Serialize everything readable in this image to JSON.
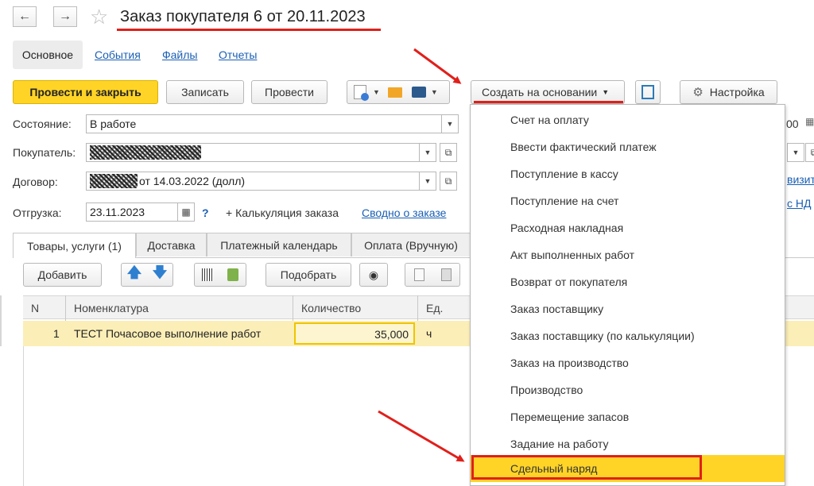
{
  "title": "Заказ покупателя 6 от 20.11.2023",
  "nav": {
    "back": "←",
    "forward": "→",
    "star": "☆"
  },
  "tabs_top": [
    "Основное",
    "События",
    "Файлы",
    "Отчеты"
  ],
  "toolbar": {
    "post_close": "Провести и закрыть",
    "save": "Записать",
    "post": "Провести",
    "create_based": "Создать на основании",
    "settings": "Настройка"
  },
  "form": {
    "state_label": "Состояние:",
    "state_value": "В работе",
    "buyer_label": "Покупатель:",
    "contract_label": "Договор:",
    "contract_value": "от 14.03.2022 (долл)",
    "shipment_label": "Отгрузка:",
    "shipment_value": "23.11.2023",
    "help": "?",
    "calc": "+ Калькуляция заказа",
    "summary": "Сводно о заказе",
    "right_fragments": [
      "00",
      "визит",
      "с НД"
    ]
  },
  "tabs": [
    "Товары, услуги (1)",
    "Доставка",
    "Платежный календарь",
    "Оплата (Вручную)"
  ],
  "grid_toolbar": {
    "add": "Добавить",
    "pick": "Подобрать"
  },
  "grid": {
    "columns": [
      "N",
      "Номенклатура",
      "Количество",
      "Ед."
    ],
    "rows": [
      {
        "n": "1",
        "name": "ТЕСТ Почасовое выполнение работ",
        "qty": "35,000",
        "unit": "ч"
      }
    ]
  },
  "menu": {
    "items": [
      "Счет на оплату",
      "Ввести фактический платеж",
      "Поступление в кассу",
      "Поступление на счет",
      "Расходная накладная",
      "Акт выполненных работ",
      "Возврат от покупателя",
      "Заказ поставщику",
      "Заказ поставщику (по калькуляции)",
      "Заказ на производство",
      "Производство",
      "Перемещение запасов",
      "Задание на работу",
      "Сдельный наряд"
    ],
    "highlighted_index": 13
  },
  "colors": {
    "accent": "#ffd426",
    "annotation": "#e0201b",
    "link": "#1a5fb4",
    "row_selected": "#fbeeb7"
  }
}
